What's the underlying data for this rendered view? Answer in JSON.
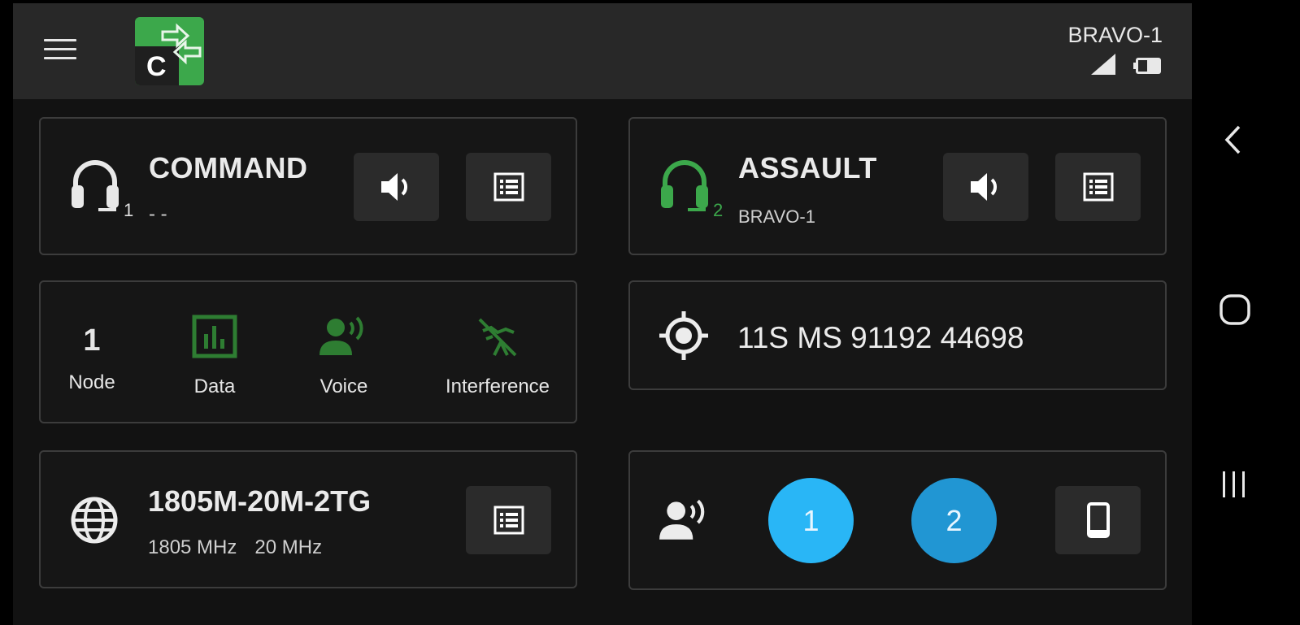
{
  "header": {
    "menu_icon": "hamburger-menu-icon",
    "logo_icon": "app-logo-icon",
    "logo_letter": "C",
    "device_name": "BRAVO-1",
    "signal_icon": "signal-strength-icon",
    "battery_icon": "battery-icon"
  },
  "channels": [
    {
      "title": "COMMAND",
      "number": "1",
      "subtitle": "- -",
      "icon": "headset-icon",
      "icon_color": "#e8e8e8",
      "number_color": "#e0e0e0"
    },
    {
      "title": "ASSAULT",
      "number": "2",
      "subtitle": "BRAVO-1",
      "icon": "headset-icon",
      "icon_color": "#3ca84b",
      "number_color": "#3ca84b"
    }
  ],
  "status": {
    "node_value": "1",
    "node_label": "Node",
    "data_label": "Data",
    "voice_label": "Voice",
    "interference_label": "Interference",
    "indicator_color": "#2e7d32"
  },
  "location": {
    "icon": "gps-crosshair-icon",
    "grid": "11S MS 91192 44698"
  },
  "network": {
    "icon": "globe-icon",
    "name": "1805M-20M-2TG",
    "frequency": "1805 MHz",
    "bandwidth": "20 MHz"
  },
  "talk": {
    "icon": "voice-speaker-icon",
    "buttons": [
      {
        "label": "1",
        "color": "#29b6f6"
      },
      {
        "label": "2",
        "color": "#2196d3"
      }
    ],
    "device_icon": "phone-device-icon"
  },
  "colors": {
    "green": "#3ca84b",
    "dark_green": "#2e7d32",
    "accent_blue": "#29b6f6"
  }
}
